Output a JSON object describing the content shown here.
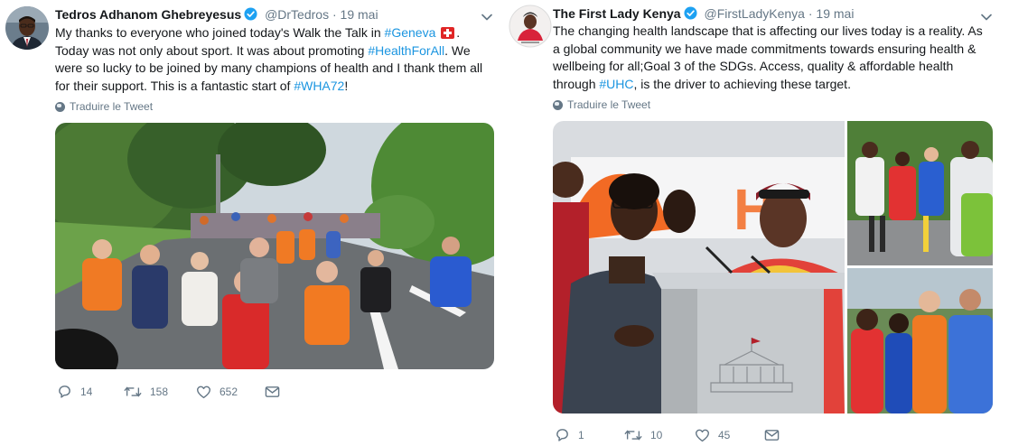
{
  "tweets": [
    {
      "author": {
        "name": "Tedros Adhanom Ghebreyesus",
        "handle": "@DrTedros",
        "date": "19 mai",
        "verified": true
      },
      "text": {
        "p1": "My thanks to everyone who joined today's Walk the Talk in ",
        "tag_geneva": "#Geneva",
        "p2": ". Today was not only about sport. It was about promoting ",
        "tag_healthforall": "#HealthForAll",
        "p3": ". We were so lucky to be joined by many champions of health and I thank them all for their support. This is a fantastic start of ",
        "tag_wha72": "#WHA72",
        "p4": "!"
      },
      "translate_label": "Traduire le Tweet",
      "counts": {
        "replies": "14",
        "retweets": "158",
        "likes": "652"
      }
    },
    {
      "author": {
        "name": "The First Lady Kenya",
        "handle": "@FirstLadyKenya",
        "date": "19 mai",
        "verified": true
      },
      "text": {
        "p1": "The changing health landscape that is affecting our lives today is a reality. As a global community we have made commitments towards ensuring health & wellbeing for all;Goal 3 of the SDGs. Access, quality & affordable health through ",
        "tag_uhc": "#UHC",
        "p2": ", is the driver to achieving these target."
      },
      "translate_label": "Traduire le Tweet",
      "counts": {
        "replies": "1",
        "retweets": "10",
        "likes": "45"
      }
    }
  ],
  "separator": "·",
  "colors": {
    "text": "#14171a",
    "muted": "#657786",
    "link": "#1b95e0",
    "verified": "#1da1f2",
    "flag": "#e02626"
  },
  "icons": [
    "verified-badge-icon",
    "chevron-down-icon",
    "globe-icon",
    "reply-icon",
    "retweet-icon",
    "like-icon",
    "dm-icon"
  ]
}
